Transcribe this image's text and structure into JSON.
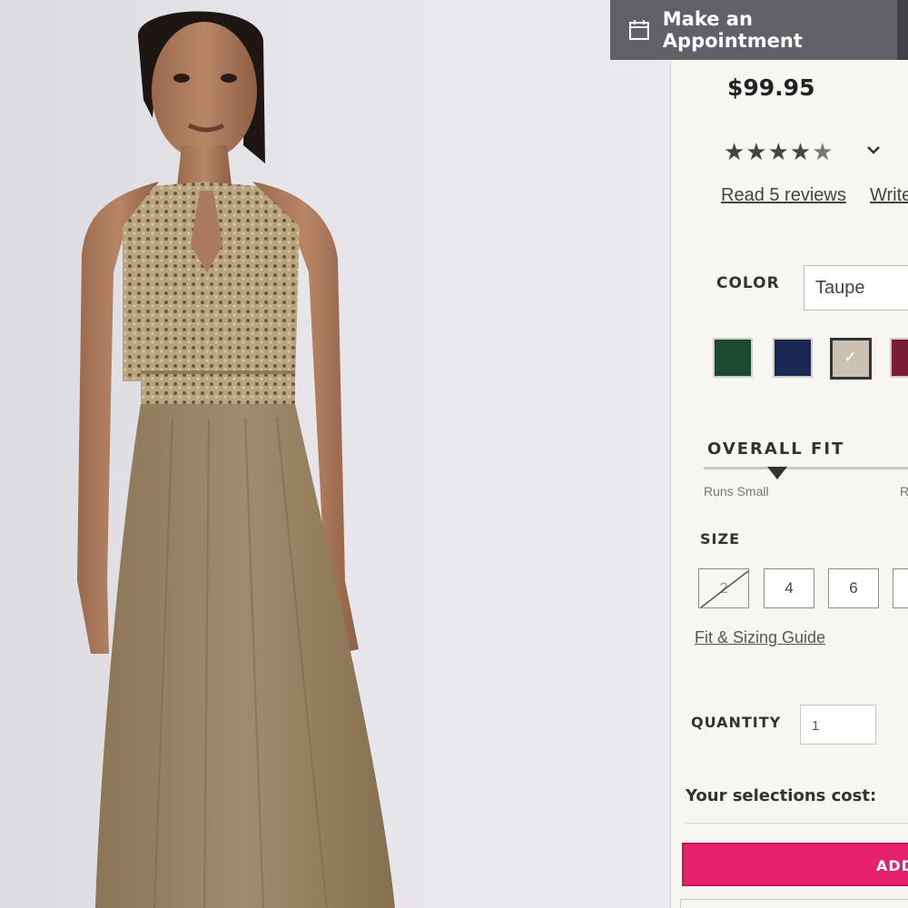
{
  "header": {
    "appointment_label": "Make an Appointment",
    "calendar_icon": "calendar-icon"
  },
  "product": {
    "price": "$99.95",
    "rating": 4.5,
    "stars_full": "★★★★",
    "stars_half": "★",
    "stars_empty": "★",
    "reviews_link": "Read 5 reviews",
    "write_link": "Write"
  },
  "color": {
    "label": "COLOR",
    "selected": "Taupe",
    "swatches": [
      "#1c4a31",
      "#1c2752",
      "#c9c2b3",
      "#7b1c36"
    ],
    "check": "✓"
  },
  "fit": {
    "label": "OVERALL FIT",
    "left_text": "Runs Small",
    "right_text": "R"
  },
  "size": {
    "label": "SIZE",
    "options": [
      "2",
      "4",
      "6",
      ""
    ],
    "guide_link": "Fit & Sizing Guide"
  },
  "quantity": {
    "label": "QUANTITY",
    "value": "1"
  },
  "summary": {
    "cost_label": "Your selections cost:",
    "add_label": "ADD"
  },
  "colors": {
    "accent": "#e8216f",
    "header_bg": "#5f6167"
  }
}
